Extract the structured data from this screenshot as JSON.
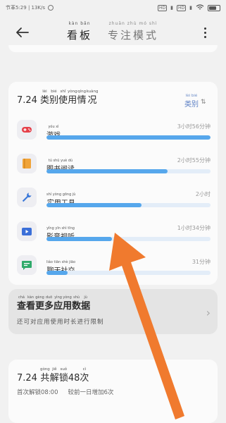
{
  "status_bar": {
    "left_text": "节革5:29 | 13K/s",
    "right_signal": "HD",
    "right_signal2": "HD"
  },
  "header": {
    "tabs": [
      {
        "label": "看板",
        "pinyin": "kàn bǎn"
      },
      {
        "label": "专注模式",
        "pinyin": "zhuān zhù mó shì"
      }
    ]
  },
  "usage": {
    "date": "7.24",
    "title_chars": [
      {
        "rb": "类",
        "rt": "lèi"
      },
      {
        "rb": "别",
        "rt": "bié"
      },
      {
        "rb": "使",
        "rt": "shǐ"
      },
      {
        "rb": "用",
        "rt": "yòng"
      },
      {
        "rb": "情",
        "rt": "qíng"
      },
      {
        "rb": "况",
        "rt": "kuàng"
      }
    ],
    "category_link": {
      "label": "类别",
      "pinyin": "lèi bié"
    },
    "apps": [
      {
        "name": "游戏",
        "pinyin": "yóu xì",
        "time": "3小时56分钟",
        "fill": 1.0,
        "icon": "gamepad-icon",
        "color": "#e5404a"
      },
      {
        "name": "图书阅读",
        "pinyin": "tú shū yuè dú",
        "time": "2小时55分钟",
        "fill": 0.74,
        "icon": "book-icon",
        "color": "#f0a43a"
      },
      {
        "name": "实用工具",
        "pinyin": "shí yòng gōng jù",
        "time": "2小时",
        "fill": 0.58,
        "icon": "wrench-icon",
        "color": "#3b78d8"
      },
      {
        "name": "影音视听",
        "pinyin": "yǐng yīn shì tīng",
        "time": "1小时34分钟",
        "fill": 0.4,
        "icon": "video-icon",
        "color": "#3b6fd8"
      },
      {
        "name": "聊天社交",
        "pinyin": "liáo tiān shè jiāo",
        "time": "31分钟",
        "fill": 0.13,
        "icon": "chat-icon",
        "color": "#2faa6a"
      }
    ]
  },
  "more": {
    "title_chars": [
      {
        "rb": "查",
        "rt": "chá"
      },
      {
        "rb": "看",
        "rt": "kàn"
      },
      {
        "rb": "更",
        "rt": "gèng"
      },
      {
        "rb": "多",
        "rt": "duō"
      },
      {
        "rb": "应",
        "rt": "yìng"
      },
      {
        "rb": "用",
        "rt": "yòng"
      },
      {
        "rb": "数",
        "rt": "shù"
      },
      {
        "rb": "据",
        "rt": "jù"
      }
    ],
    "description": "还可对应用使用时长进行限制"
  },
  "unlock": {
    "date": "7.24",
    "title_chars": [
      {
        "rb": "共",
        "rt": "gòng"
      },
      {
        "rb": "解",
        "rt": "jiě"
      },
      {
        "rb": "锁",
        "rt": "suǒ"
      },
      {
        "rb": "48",
        "rt": ""
      },
      {
        "rb": "次",
        "rt": "cì"
      }
    ],
    "first_unlock": "首次解锁08:00",
    "compare": "较前一日增加6次"
  },
  "colors": {
    "accent": "#56a7ec",
    "track": "#e3edf8",
    "annotation_arrow": "#f07a2e"
  }
}
